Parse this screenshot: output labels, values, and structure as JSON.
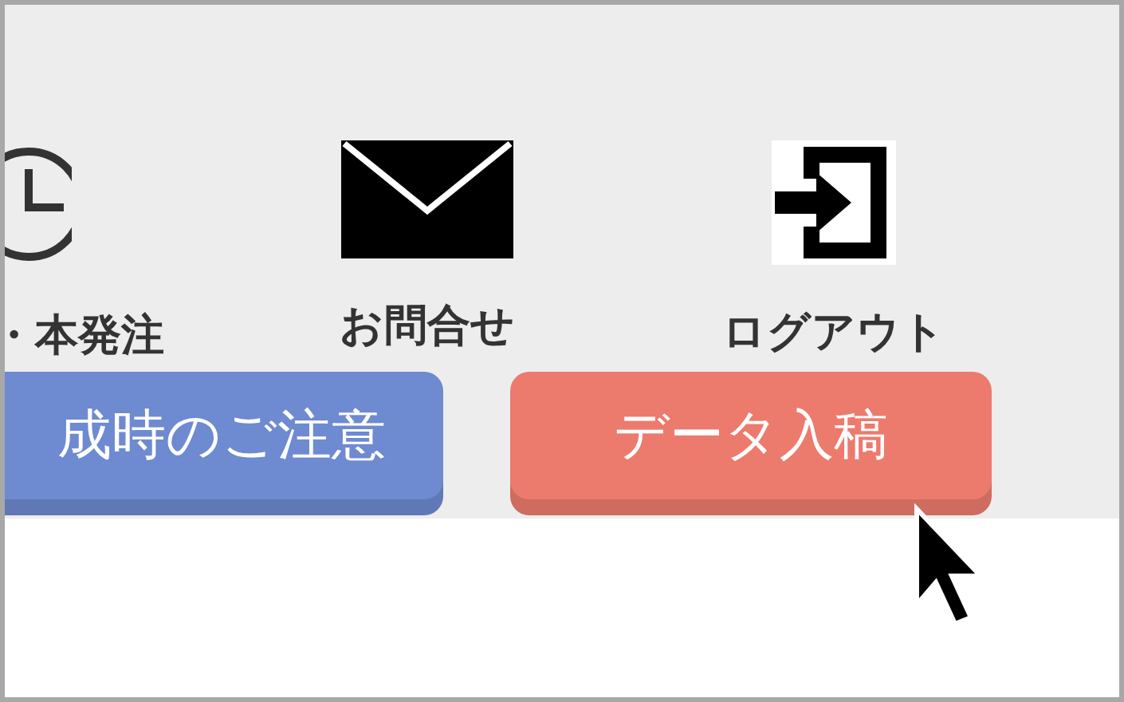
{
  "nav_items": [
    {
      "label": "・本発注"
    },
    {
      "label": "お問合せ"
    },
    {
      "label": "ログアウト"
    }
  ],
  "buttons": [
    {
      "label": "成時のご注意",
      "color": "#6e8ad0"
    },
    {
      "label": "データ入稿",
      "color": "#ec7b6e"
    }
  ]
}
